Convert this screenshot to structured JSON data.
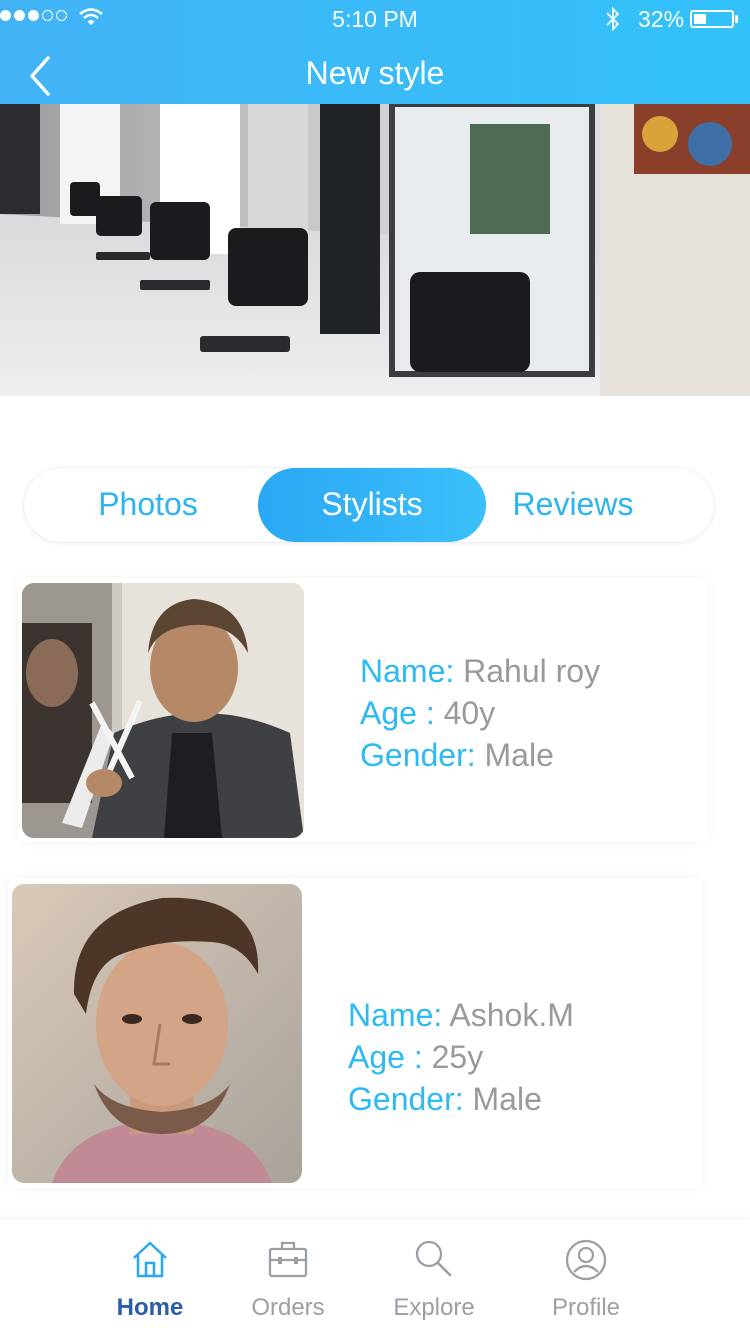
{
  "status_bar": {
    "time": "5:10 PM",
    "battery_percent": "32%",
    "battery_level": 0.32
  },
  "header": {
    "title": "New style",
    "back_icon": "chevron-left-icon"
  },
  "hero": {
    "image": "salon-interior-photo"
  },
  "tabs": [
    {
      "label": "Photos",
      "selected": false
    },
    {
      "label": "Stylists",
      "selected": true
    },
    {
      "label": "Reviews",
      "selected": false
    }
  ],
  "stylists": [
    {
      "name_label": "Name:",
      "name": "Rahul roy",
      "age_label": "Age :",
      "age": "40y",
      "gender_label": "Gender:",
      "gender": "Male"
    },
    {
      "name_label": "Name:",
      "name": "Ashok.M",
      "age_label": "Age :",
      "age": "25y",
      "gender_label": "Gender:",
      "gender": "Male"
    }
  ],
  "bottom_nav": [
    {
      "label": "Home",
      "icon": "home-icon",
      "active": true
    },
    {
      "label": "Orders",
      "icon": "briefcase-icon",
      "active": false
    },
    {
      "label": "Explore",
      "icon": "search-icon",
      "active": false
    },
    {
      "label": "Profile",
      "icon": "user-icon",
      "active": false
    }
  ],
  "colors": {
    "header": "#33b9f8",
    "accent": "#2db9f2",
    "nav_active": "#2b5da8",
    "muted": "#9a9a9a"
  }
}
